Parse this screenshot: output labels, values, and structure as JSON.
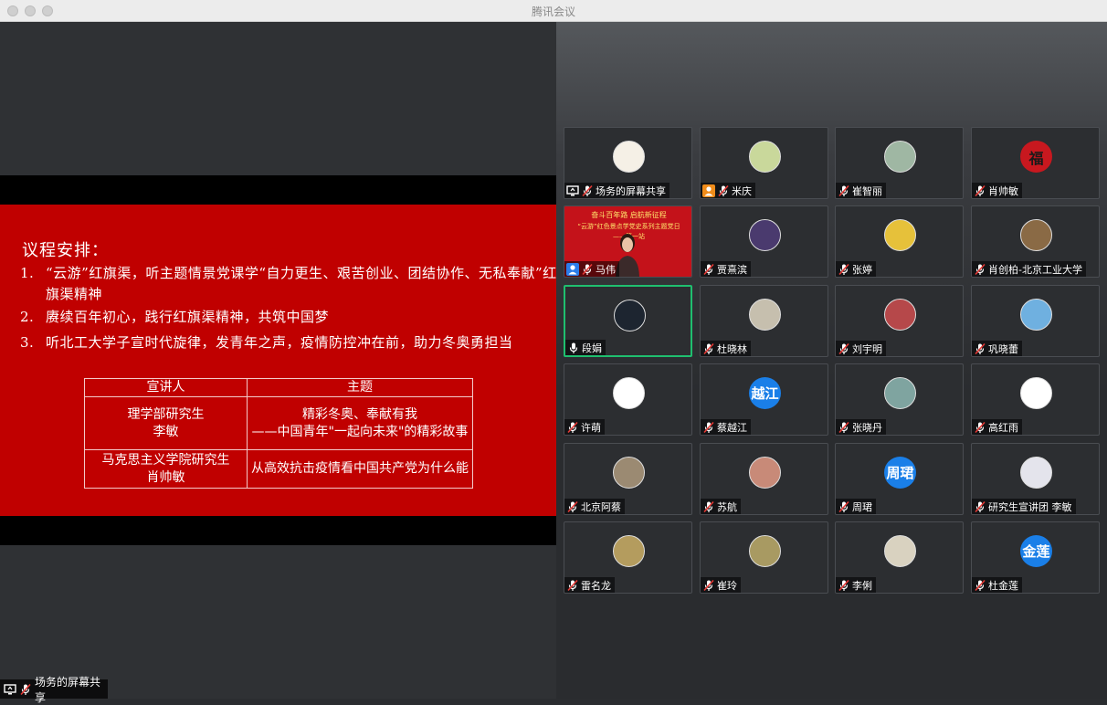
{
  "window": {
    "title": "腾讯会议"
  },
  "slide": {
    "heading": "议程安排：",
    "items": [
      {
        "num": "1.",
        "text": "“云游”红旗渠，听主题情景党课学“自力更生、艰苦创业、团结协作、无私奉献”红旗渠精神"
      },
      {
        "num": "2.",
        "text": "赓续百年初心，践行红旗渠精神，共筑中国梦"
      },
      {
        "num": "3.",
        "text": "听北工大学子宣时代旋律，发青年之声，疫情防控冲在前，助力冬奥勇担当"
      }
    ],
    "table": {
      "headers": [
        "宣讲人",
        "主题"
      ],
      "rows": [
        {
          "speaker_line1": "理学部研究生",
          "speaker_line2": "李敏",
          "topic_line1": "精彩冬奥、奉献有我",
          "topic_line2": "——中国青年\"一起向未来\"的精彩故事"
        },
        {
          "speaker_line1": "马克思主义学院研究生",
          "speaker_line2": "肖帅敏",
          "topic_line1": "从高效抗击疫情看中国共产党为什么能",
          "topic_line2": ""
        }
      ]
    }
  },
  "share_label": "场务的屏幕共享",
  "video_ma": {
    "line1": "奋斗百年路 启航新征程",
    "line2": "“云游”红色景点学党史系列主题党日",
    "line3": "——第一站"
  },
  "participants": [
    {
      "name": "场务的屏幕共享",
      "avatar_text": "",
      "avatar_color": "#f5f0e6",
      "extra": "share"
    },
    {
      "name": "米庆",
      "avatar_text": "",
      "avatar_color": "#c9d89b",
      "extra": "person-orange"
    },
    {
      "name": "崔智丽",
      "avatar_text": "",
      "avatar_color": "#9fb7a3"
    },
    {
      "name": "肖帅敏",
      "avatar_text": "福",
      "avatar_color": "#c8181f"
    },
    {
      "name": "马伟",
      "avatar_text": "",
      "avatar_color": "#c4121a",
      "extra": "person-blue"
    },
    {
      "name": "贾熹滨",
      "avatar_text": "",
      "avatar_color": "#4a3a6e"
    },
    {
      "name": "张婷",
      "avatar_text": "",
      "avatar_color": "#e6c13a"
    },
    {
      "name": "肖创柏-北京工业大学",
      "avatar_text": "",
      "avatar_color": "#8a6a45"
    },
    {
      "name": "段娟",
      "avatar_text": "",
      "avatar_color": "#1d2530",
      "active": true
    },
    {
      "name": "杜晓林",
      "avatar_text": "",
      "avatar_color": "#c6bfae"
    },
    {
      "name": "刘宇明",
      "avatar_text": "",
      "avatar_color": "#b6484a"
    },
    {
      "name": "巩晓蕾",
      "avatar_text": "",
      "avatar_color": "#6fb0e0"
    },
    {
      "name": "许萌",
      "avatar_text": "",
      "avatar_color": "#ffffff"
    },
    {
      "name": "蔡越江",
      "avatar_text": "越江",
      "avatar_color": "#1a7fe8"
    },
    {
      "name": "张晓丹",
      "avatar_text": "",
      "avatar_color": "#7fa4a0"
    },
    {
      "name": "高红雨",
      "avatar_text": "",
      "avatar_color": "#ffffff"
    },
    {
      "name": "北京阿蔡",
      "avatar_text": "",
      "avatar_color": "#9b8a72"
    },
    {
      "name": "苏航",
      "avatar_text": "",
      "avatar_color": "#c88a78"
    },
    {
      "name": "周珺",
      "avatar_text": "周珺",
      "avatar_color": "#1a7fe8"
    },
    {
      "name": "研究生宣讲团 李敏",
      "avatar_text": "",
      "avatar_color": "#e4e4ec"
    },
    {
      "name": "雷名龙",
      "avatar_text": "",
      "avatar_color": "#b49c5e"
    },
    {
      "name": "崔玲",
      "avatar_text": "",
      "avatar_color": "#a89a62"
    },
    {
      "name": "李俐",
      "avatar_text": "",
      "avatar_color": "#d9d2c0"
    },
    {
      "name": "杜金莲",
      "avatar_text": "金莲",
      "avatar_color": "#1a7fe8"
    }
  ],
  "colors": {
    "slide_red": "#c00000",
    "active_border": "#1fbf6f",
    "avatar_blue": "#1a7fe8"
  },
  "icons": {
    "mic": "microphone-muted-icon",
    "share": "screen-share-icon",
    "person": "person-icon"
  }
}
